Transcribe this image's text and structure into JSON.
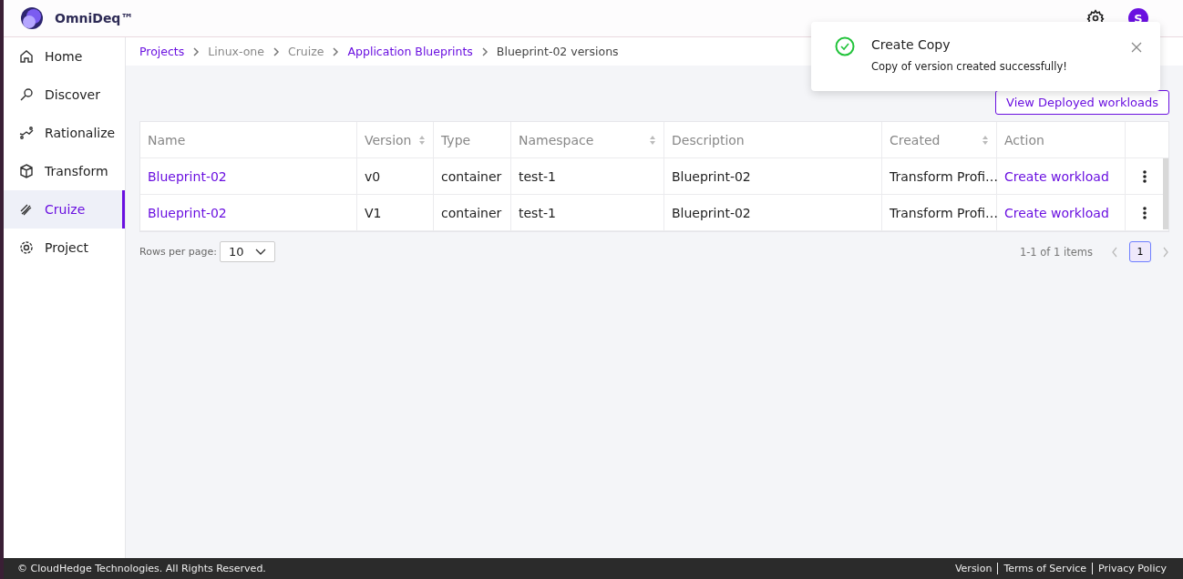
{
  "header": {
    "brand": "OmniDeq™",
    "avatar": "S"
  },
  "sidebar": {
    "items": [
      {
        "label": "Home",
        "selected": false
      },
      {
        "label": "Discover",
        "selected": false
      },
      {
        "label": "Rationalize",
        "selected": false
      },
      {
        "label": "Transform",
        "selected": false
      },
      {
        "label": "Cruize",
        "selected": true
      },
      {
        "label": "Project",
        "selected": false
      }
    ]
  },
  "breadcrumb": [
    {
      "label": "Projects",
      "kind": "link"
    },
    {
      "label": "Linux-one",
      "kind": "plain"
    },
    {
      "label": "Cruize",
      "kind": "plain"
    },
    {
      "label": "Application Blueprints",
      "kind": "link"
    },
    {
      "label": "Blueprint-02 versions",
      "kind": "current"
    }
  ],
  "view_button": "View Deployed workloads",
  "table": {
    "columns": [
      {
        "label": "Name",
        "sortable": false
      },
      {
        "label": "Version",
        "sortable": true
      },
      {
        "label": "Type",
        "sortable": false
      },
      {
        "label": "Namespace",
        "sortable": true
      },
      {
        "label": "Description",
        "sortable": false
      },
      {
        "label": "Created",
        "sortable": true
      },
      {
        "label": "Action",
        "sortable": false
      }
    ],
    "rows": [
      {
        "name": "Blueprint-02",
        "version": "v0",
        "type": "container",
        "namespace": "test-1",
        "description": "Blueprint-02",
        "created": "Transform Profi…",
        "action": "Create workload"
      },
      {
        "name": "Blueprint-02",
        "version": "V1",
        "type": "container",
        "namespace": "test-1",
        "description": "Blueprint-02",
        "created": "Transform Profi…",
        "action": "Create workload"
      }
    ]
  },
  "pagination": {
    "rows_per_page_label": "Rows per page:",
    "rows_per_page": "10",
    "range": "1-1 of 1 items",
    "pages": [
      {
        "label": "1",
        "selected": true
      }
    ]
  },
  "toast": {
    "title": "Create Copy",
    "message": "Copy of version created successfully!"
  },
  "footer": {
    "copyright": "© CloudHedge Technologies. All Rights Reserved.",
    "links": [
      "Version",
      "Terms of Service",
      "Privacy Policy"
    ]
  }
}
